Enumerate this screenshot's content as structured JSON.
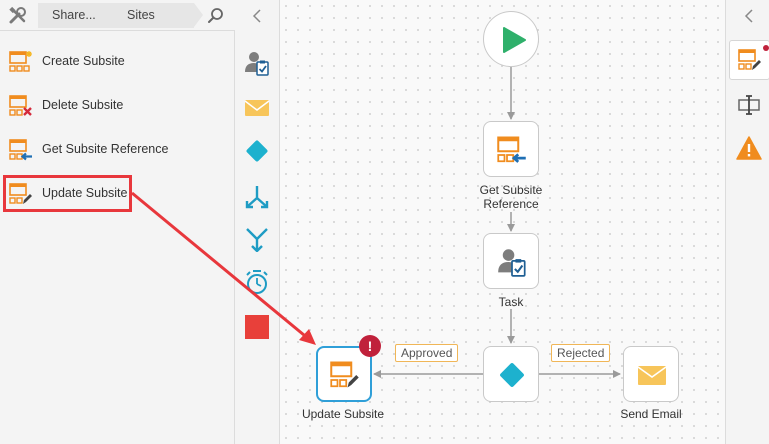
{
  "breadcrumb": {
    "items": [
      "Share...",
      "Sites"
    ]
  },
  "icons": {
    "tools": "tools-icon",
    "search": "search-icon",
    "collapse": "chevron-left-icon"
  },
  "actions": [
    {
      "label": "Create Subsite",
      "icon": "create-subsite-icon"
    },
    {
      "label": "Delete Subsite",
      "icon": "delete-subsite-icon"
    },
    {
      "label": "Get Subsite Reference",
      "icon": "get-subsite-reference-icon"
    },
    {
      "label": "Update Subsite",
      "icon": "update-subsite-icon",
      "highlighted": true
    }
  ],
  "toolbox": [
    "user-task-icon",
    "email-icon",
    "decision-icon",
    "split-icon",
    "merge-icon",
    "timer-icon",
    "stop-icon"
  ],
  "workflow": {
    "nodes": [
      {
        "id": "start",
        "label": ""
      },
      {
        "id": "get-subsite-reference",
        "label_lines": [
          "Get Subsite",
          "Reference"
        ]
      },
      {
        "id": "task",
        "label": "Task"
      },
      {
        "id": "decision",
        "label": ""
      },
      {
        "id": "update-subsite",
        "label": "Update Subsite",
        "selected": true,
        "error_badge": "!"
      },
      {
        "id": "send-email",
        "label": "Send Email"
      }
    ],
    "branches": {
      "approved": "Approved",
      "rejected": "Rejected"
    }
  },
  "right_panel": [
    "action-properties-icon",
    "configuration-icon",
    "warning-icon"
  ],
  "colors": {
    "accent_orange": "#f08c1e",
    "highlight_red": "#e8373c",
    "teal": "#1db1ce",
    "start_green": "#2fb06b",
    "error_badge": "#c0213b",
    "email_yellow": "#f7c55a",
    "selected_border": "#2f9fd8"
  }
}
